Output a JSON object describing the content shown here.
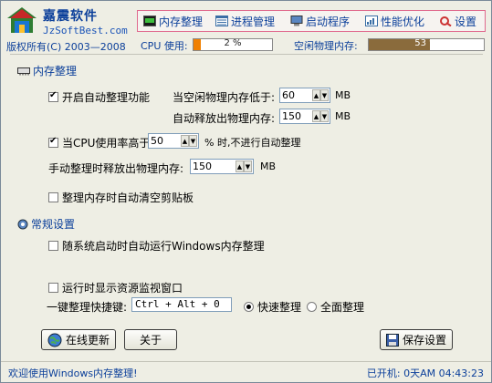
{
  "brand": {
    "name": "嘉震软件",
    "url": "JzSoftBest.com",
    "copyright": "版权所有(C) 2003—2008"
  },
  "toolbar": {
    "items": [
      {
        "label": "内存整理",
        "icon": "memory-chip-icon"
      },
      {
        "label": "进程管理",
        "icon": "process-list-icon"
      },
      {
        "label": "启动程序",
        "icon": "startup-computer-icon"
      },
      {
        "label": "性能优化",
        "icon": "optimize-icon"
      },
      {
        "label": "设置",
        "icon": "settings-icon"
      }
    ]
  },
  "monitor": {
    "cpu_label": "CPU 使用:",
    "cpu_value_text": "2 %",
    "cpu_percent": 2,
    "mem_label": "空闲物理内存:",
    "mem_value_text": "53 %",
    "mem_percent": 53
  },
  "colors": {
    "cpu_fill": "#f08000",
    "mem_fill": "#8a6b3c",
    "accent": "#0b3f9a",
    "toolbar_border": "#e06a8e"
  },
  "memory_section": {
    "title": "内存整理",
    "auto_enable_label": "开启自动整理功能",
    "auto_enable_checked": true,
    "threshold_label": "当空闲物理内存低于:",
    "threshold_value": "60",
    "threshold_unit": "MB",
    "auto_release_label": "自动释放出物理内存:",
    "auto_release_value": "150",
    "auto_release_unit": "MB",
    "cpu_condition_label": "当CPU使用率高于",
    "cpu_condition_checked": true,
    "cpu_condition_value": "50",
    "cpu_condition_suffix": "% 时,不进行自动整理",
    "manual_release_label": "手动整理时释放出物理内存:",
    "manual_release_value": "150",
    "manual_release_unit": "MB",
    "clear_clipboard_label": "整理内存时自动清空剪贴板",
    "clear_clipboard_checked": false
  },
  "general_section": {
    "title": "常规设置",
    "autostart_label": "随系统启动时自动运行Windows内存整理",
    "autostart_checked": false,
    "show_monitor_label": "运行时显示资源监视窗口",
    "show_monitor_checked": false,
    "hotkey_label": "一键整理快捷键:",
    "hotkey_value": "Ctrl + Alt + 0",
    "radio_fast_label": "快速整理",
    "radio_fast_selected": true,
    "radio_full_label": "全面整理",
    "radio_full_selected": false
  },
  "buttons": {
    "online_update": "在线更新",
    "about": "关于",
    "save": "保存设置"
  },
  "status": {
    "welcome": "欢迎使用Windows内存整理!",
    "uptime": "已开机: 0天AM 04:43:23"
  }
}
